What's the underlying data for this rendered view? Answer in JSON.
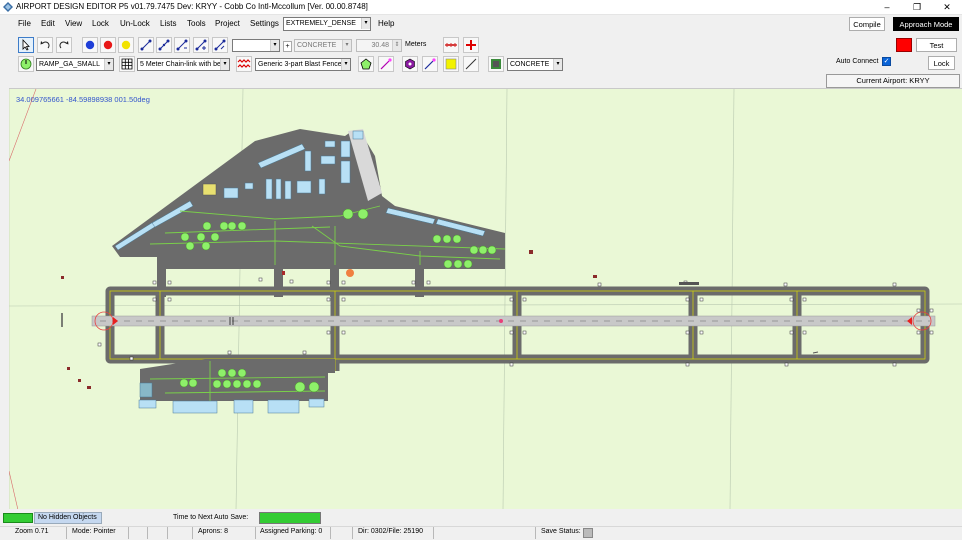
{
  "window": {
    "title": "AIRPORT DESIGN EDITOR P5  v01.79.7475 Dev: KRYY - Cobb Co Intl-Mccollum [Ver. 00.00.8748]",
    "minimize": "–",
    "maximize": "❐",
    "close": "✕"
  },
  "menu": {
    "items": [
      "File",
      "Edit",
      "View",
      "Lock",
      "Un-Lock",
      "Lists",
      "Tools",
      "Project",
      "Settings",
      "Help"
    ],
    "density": "EXTREMELY_DENSE"
  },
  "buttons": {
    "compile": "Compile",
    "approach_mode": "Approach Mode",
    "test": "Test",
    "lock": "Lock"
  },
  "toolbar1": {
    "blank_combo": "",
    "plus": "+",
    "surface": "CONCRETE",
    "width_value": "30.48",
    "units": "Meters"
  },
  "toolbar2": {
    "ramp": "RAMP_GA_SMALL",
    "fence": "5 Meter Chain-link with be",
    "blast_fence": "Generic 3-part Blast Fence",
    "surface2": "CONCRETE"
  },
  "right_panel": {
    "auto_connect": "Auto Connect",
    "current_airport": "Current Airport: KRYY",
    "accent": "#ff0000"
  },
  "map": {
    "coordinates": "34.009765661  -84.59898938 001.50deg"
  },
  "status": {
    "hidden_objects": "No Hidden Objects",
    "auto_save_label": "Time to Next Auto Save:",
    "auto_save_progress": 1.0,
    "zoom": "Zoom 0.71",
    "mode": "Mode: Pointer",
    "aprons": "Aprons: 8",
    "parking": "Assigned Parking: 0",
    "dir": "Dir: 0302/File: 25190",
    "save_status": "Save Status:"
  },
  "colors": {
    "map_bg": "#eaf8d6",
    "pavement": "#6b6b6b",
    "taxiway_line": "#d9d900",
    "taxiway_center": "#7ad04a",
    "building": "#b8e0f5",
    "tree": "#8ef06a",
    "status_green": "#33cc33"
  }
}
